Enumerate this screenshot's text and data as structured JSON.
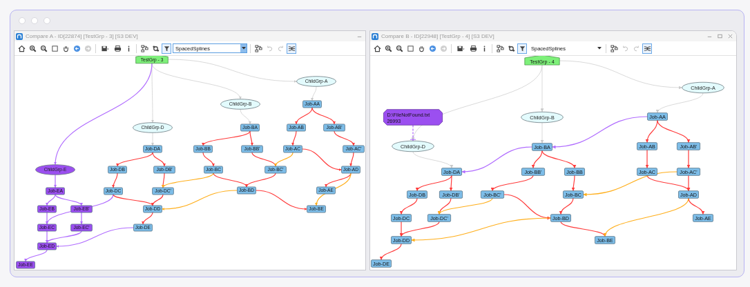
{
  "panels": [
    {
      "title": "Compare A - ID[22874] [TestGrp - 3] [S3 DEV]",
      "window_controls": [
        {
          "kind": "minimize"
        }
      ],
      "toolbar": [
        {
          "kind": "home",
          "disabled": false,
          "selected": false
        },
        {
          "kind": "zoom-in",
          "disabled": false,
          "selected": false
        },
        {
          "kind": "zoom-out",
          "disabled": false,
          "selected": false
        },
        {
          "kind": "select",
          "disabled": false,
          "selected": false
        },
        {
          "kind": "pan",
          "disabled": false,
          "selected": false
        },
        {
          "kind": "back",
          "disabled": false,
          "selected": false
        },
        {
          "kind": "forward",
          "disabled": true,
          "selected": false
        },
        {
          "kind": "separator"
        },
        {
          "kind": "save",
          "disabled": false,
          "selected": false
        },
        {
          "kind": "print",
          "disabled": false,
          "selected": false
        },
        {
          "kind": "info",
          "disabled": false,
          "selected": false
        },
        {
          "kind": "separator"
        },
        {
          "kind": "layout",
          "disabled": false,
          "selected": false
        },
        {
          "kind": "cluster",
          "disabled": false,
          "selected": false
        },
        {
          "kind": "filter",
          "disabled": false,
          "selected": true
        },
        {
          "kind": "dropdown",
          "value": "SpacedSplines",
          "focused": true
        },
        {
          "kind": "separator"
        },
        {
          "kind": "arrange",
          "disabled": false,
          "selected": false
        },
        {
          "kind": "undo",
          "disabled": true,
          "selected": false
        },
        {
          "kind": "redo",
          "disabled": true,
          "selected": false
        },
        {
          "kind": "compact",
          "disabled": false,
          "selected": true
        }
      ],
      "nodes": [
        {
          "label": "TestGrp - 3",
          "kind": "group"
        },
        {
          "label": "ChildGrp-A",
          "kind": "child"
        },
        {
          "label": "ChildGrp-B",
          "kind": "child"
        },
        {
          "label": "Job-AA",
          "kind": "job"
        },
        {
          "label": "ChildGrp-D",
          "kind": "child"
        },
        {
          "label": "Job-BA",
          "kind": "job"
        },
        {
          "label": "Job-AB",
          "kind": "job"
        },
        {
          "label": "Job-AB'",
          "kind": "job"
        },
        {
          "label": "Job-DA",
          "kind": "job"
        },
        {
          "label": "Job-BB",
          "kind": "job"
        },
        {
          "label": "Job-BB'",
          "kind": "job"
        },
        {
          "label": "Job-AC",
          "kind": "job"
        },
        {
          "label": "Job-AC'",
          "kind": "job"
        },
        {
          "label": "ChildGrp-E",
          "kind": "child-error"
        },
        {
          "label": "Job-DB",
          "kind": "job"
        },
        {
          "label": "Job-DB'",
          "kind": "job"
        },
        {
          "label": "Job-BC",
          "kind": "job"
        },
        {
          "label": "Job-BC'",
          "kind": "job"
        },
        {
          "label": "Job-AD",
          "kind": "job"
        },
        {
          "label": "Job-EA",
          "kind": "job-error"
        },
        {
          "label": "Job-DC",
          "kind": "job"
        },
        {
          "label": "Job-DC'",
          "kind": "job"
        },
        {
          "label": "Job-BD",
          "kind": "job"
        },
        {
          "label": "Job-AE",
          "kind": "job"
        },
        {
          "label": "Job-EB",
          "kind": "job-error"
        },
        {
          "label": "Job-EB'",
          "kind": "job-error"
        },
        {
          "label": "Job-DD",
          "kind": "job"
        },
        {
          "label": "Job-BE",
          "kind": "job"
        },
        {
          "label": "Job-EC",
          "kind": "job-error"
        },
        {
          "label": "Job-EC'",
          "kind": "job-error"
        },
        {
          "label": "Job-DE",
          "kind": "job"
        },
        {
          "label": "Job-ED",
          "kind": "job-error"
        },
        {
          "label": "Job-EE",
          "kind": "job-error"
        }
      ]
    },
    {
      "title": "Compare B - ID[22948] [TestGrp - 4] [S3 DEV]",
      "window_controls": [
        {
          "kind": "minimize"
        },
        {
          "kind": "maximize"
        },
        {
          "kind": "close"
        }
      ],
      "toolbar": [
        {
          "kind": "home",
          "disabled": false,
          "selected": false
        },
        {
          "kind": "zoom-in",
          "disabled": false,
          "selected": false
        },
        {
          "kind": "zoom-out",
          "disabled": false,
          "selected": false
        },
        {
          "kind": "select",
          "disabled": false,
          "selected": false
        },
        {
          "kind": "pan",
          "disabled": false,
          "selected": false
        },
        {
          "kind": "back",
          "disabled": false,
          "selected": false
        },
        {
          "kind": "forward",
          "disabled": true,
          "selected": false
        },
        {
          "kind": "separator"
        },
        {
          "kind": "save",
          "disabled": false,
          "selected": false
        },
        {
          "kind": "print",
          "disabled": false,
          "selected": false
        },
        {
          "kind": "info",
          "disabled": false,
          "selected": false
        },
        {
          "kind": "separator"
        },
        {
          "kind": "layout",
          "disabled": false,
          "selected": false
        },
        {
          "kind": "cluster",
          "disabled": false,
          "selected": false
        },
        {
          "kind": "filter",
          "disabled": false,
          "selected": true
        },
        {
          "kind": "dropdown",
          "value": "SpacedSplines",
          "focused": false
        },
        {
          "kind": "separator"
        },
        {
          "kind": "arrange",
          "disabled": false,
          "selected": false
        },
        {
          "kind": "undo",
          "disabled": true,
          "selected": false
        },
        {
          "kind": "redo",
          "disabled": true,
          "selected": false
        },
        {
          "kind": "compact",
          "disabled": false,
          "selected": true
        }
      ],
      "nodes": [
        {
          "label": "TestGrp - 4",
          "kind": "group"
        },
        {
          "label": "ChildGrp-A",
          "kind": "child"
        },
        {
          "label": "D:\\FileNotFound.txt",
          "detail": "26993",
          "kind": "file"
        },
        {
          "label": "ChildGrp-B",
          "kind": "child"
        },
        {
          "label": "Job-AA",
          "kind": "job"
        },
        {
          "label": "ChildGrp-D",
          "kind": "child"
        },
        {
          "label": "Job-BA",
          "kind": "job"
        },
        {
          "label": "Job-AB",
          "kind": "job"
        },
        {
          "label": "Job-AB'",
          "kind": "job"
        },
        {
          "label": "Job-DA",
          "kind": "job"
        },
        {
          "label": "Job-BB'",
          "kind": "job"
        },
        {
          "label": "Job-BB",
          "kind": "job"
        },
        {
          "label": "Job-AC",
          "kind": "job"
        },
        {
          "label": "Job-AC'",
          "kind": "job"
        },
        {
          "label": "Job-DB",
          "kind": "job"
        },
        {
          "label": "Job-DB'",
          "kind": "job"
        },
        {
          "label": "Job-BC'",
          "kind": "job"
        },
        {
          "label": "Job-BC",
          "kind": "job"
        },
        {
          "label": "Job-AD",
          "kind": "job"
        },
        {
          "label": "Job-DC",
          "kind": "job"
        },
        {
          "label": "Job-DC'",
          "kind": "job"
        },
        {
          "label": "Job-BD",
          "kind": "job"
        },
        {
          "label": "Job-AE",
          "kind": "job"
        },
        {
          "label": "Job-DD",
          "kind": "job"
        },
        {
          "label": "Job-BE",
          "kind": "job"
        },
        {
          "label": "Job-DE",
          "kind": "job"
        }
      ]
    }
  ]
}
